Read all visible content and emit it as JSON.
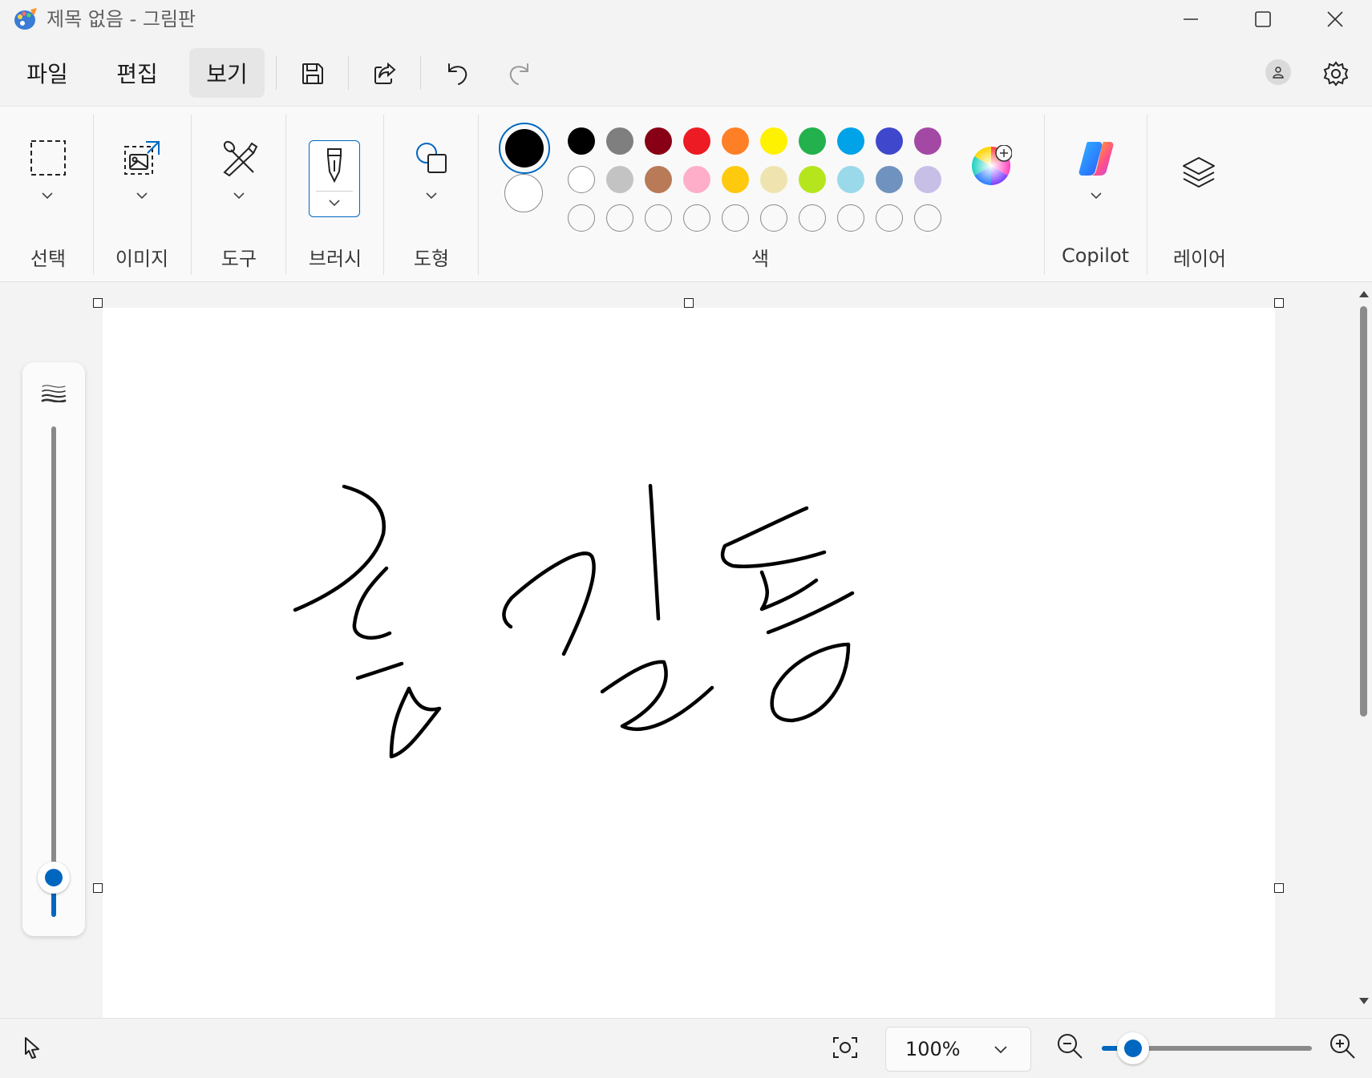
{
  "window": {
    "title": "제목 없음 - 그림판",
    "controls": [
      "minimize-icon",
      "maximize-icon",
      "close-icon"
    ]
  },
  "menu": {
    "items": [
      {
        "label": "파일"
      },
      {
        "label": "편집"
      },
      {
        "label": "보기",
        "active": true
      }
    ],
    "icons": [
      "save-icon",
      "share-icon",
      "undo-icon",
      "redo-icon"
    ],
    "right_icons": [
      "account-icon",
      "settings-icon"
    ]
  },
  "ribbon": {
    "groups": [
      {
        "label": "선택",
        "icon": "selection-icon"
      },
      {
        "label": "이미지",
        "icon": "image-icon"
      },
      {
        "label": "도구",
        "icon": "tools-icon"
      },
      {
        "label": "브러시",
        "icon": "brush-icon"
      },
      {
        "label": "도형",
        "icon": "shapes-icon"
      },
      {
        "label": "색",
        "icon": "palette"
      },
      {
        "label": "Copilot",
        "icon": "copilot-icon"
      },
      {
        "label": "레이어",
        "icon": "layers-icon"
      }
    ],
    "colors": {
      "primary": "#000000",
      "secondary": "#ffffff",
      "row1": [
        "#000000",
        "#7f7f7f",
        "#880015",
        "#ed1c24",
        "#ff7f27",
        "#fff200",
        "#22b14c",
        "#00a2e8",
        "#3f48cc",
        "#a349a4"
      ],
      "row2": [
        "#ffffff",
        "#c3c3c3",
        "#b97a57",
        "#ffaec9",
        "#ffc90e",
        "#efe4b0",
        "#b5e61d",
        "#99d9ea",
        "#7092be",
        "#c8bfe7"
      ],
      "row3_empty_count": 10
    }
  },
  "brush_size": {
    "icon": "stroke-size-icon",
    "level": 0.08
  },
  "canvas": {
    "drawing": "handwritten-signature"
  },
  "status": {
    "pointer_icon": "pointer-icon",
    "fit_icon": "fit-to-window-icon",
    "zoom": "100%",
    "zoom_level": 0.15,
    "zoom_out_icon": "zoom-out-icon",
    "zoom_in_icon": "zoom-in-icon"
  }
}
